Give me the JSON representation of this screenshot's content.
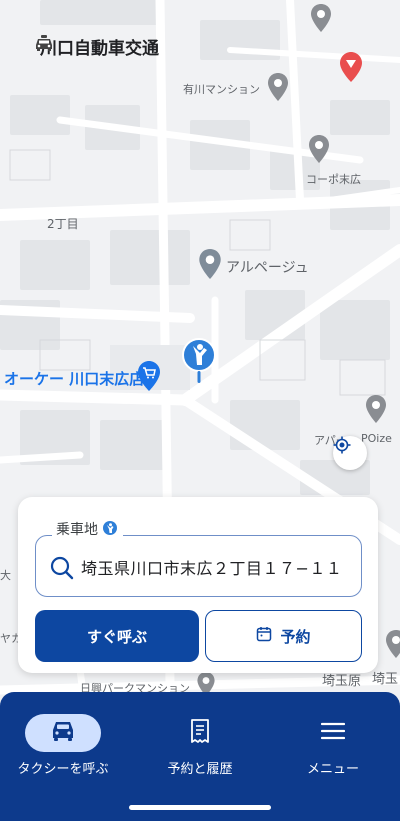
{
  "header": {
    "company_name": "川口自動車交通",
    "icon": "taxi-icon"
  },
  "map": {
    "labels": {
      "arikawa": "有川マンション",
      "copo": "コーポ末広",
      "chome2": "2丁目",
      "alpage": "アルページュ",
      "okay": "オーケー 川口末広店",
      "apar": "アパー",
      "poize": "POize",
      "ohmo": "大",
      "yaka": "ヤカ",
      "nikki": "日興パークマンション",
      "saitama": "埼玉",
      "saitama_edge": "埼玉原"
    }
  },
  "booking_card": {
    "pickup_label": "乗車地",
    "pickup_address": "埼玉県川口市末広２丁目１７−１１",
    "call_now_label": "すぐ呼ぶ",
    "reserve_label": "予約"
  },
  "bottom_nav": {
    "items": [
      {
        "label": "タクシーを呼ぶ",
        "icon": "car-icon"
      },
      {
        "label": "予約と履歴",
        "icon": "receipt-icon"
      },
      {
        "label": "メニュー",
        "icon": "menu-icon"
      }
    ]
  },
  "colors": {
    "primary": "#0d47a1",
    "nav_bg": "#0d3a8c",
    "nav_active_pill": "#cfe0ff",
    "poi_blue": "#1a73e8"
  }
}
